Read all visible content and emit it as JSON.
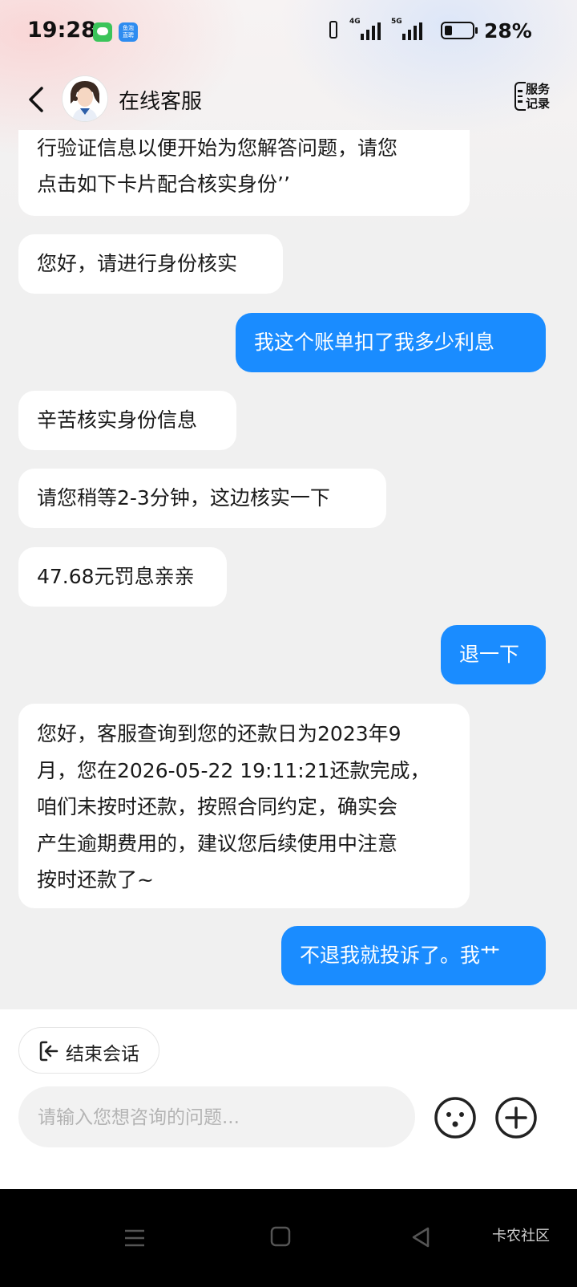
{
  "status_bar": {
    "time": "19:28",
    "app_icon_text": "鱼泡\n直聘",
    "network_1": "4G",
    "network_2": "5G",
    "battery_percent": "28%",
    "battery_level": 0.28
  },
  "header": {
    "title": "在线客服",
    "service_record_label": "服务\n记录"
  },
  "messages": [
    {
      "side": "in",
      "text": "行验证信息以便开始为您解答问题，请您\n点击如下卡片配合核实身份’’"
    },
    {
      "side": "in",
      "text": "您好，请进行身份核实"
    },
    {
      "side": "out",
      "text": "我这个账单扣了我多少利息"
    },
    {
      "side": "in",
      "text": "辛苦核实身份信息"
    },
    {
      "side": "in",
      "text": "请您稍等2-3分钟，这边核实一下"
    },
    {
      "side": "in",
      "text": "47.68元罚息亲亲"
    },
    {
      "side": "out",
      "text": "退一下"
    },
    {
      "side": "in",
      "text": "您好，客服查询到您的还款日为2023年9\n月，您在2026-05-22 19:11:21还款完成，\n咱们未按时还款，按照合同约定，确实会\n产生逾期费用的，建议您后续使用中注意\n按时还款了~"
    },
    {
      "side": "out",
      "text": "不退我就投诉了。我艹"
    }
  ],
  "bottom": {
    "end_session_label": "结束会话",
    "input_placeholder": "请输入您想咨询的问题..."
  },
  "watermark": "卡农社区",
  "colors": {
    "outgoing_bubble": "#1a8cff",
    "incoming_bubble": "#ffffff",
    "chat_background": "#f0f0f0"
  }
}
